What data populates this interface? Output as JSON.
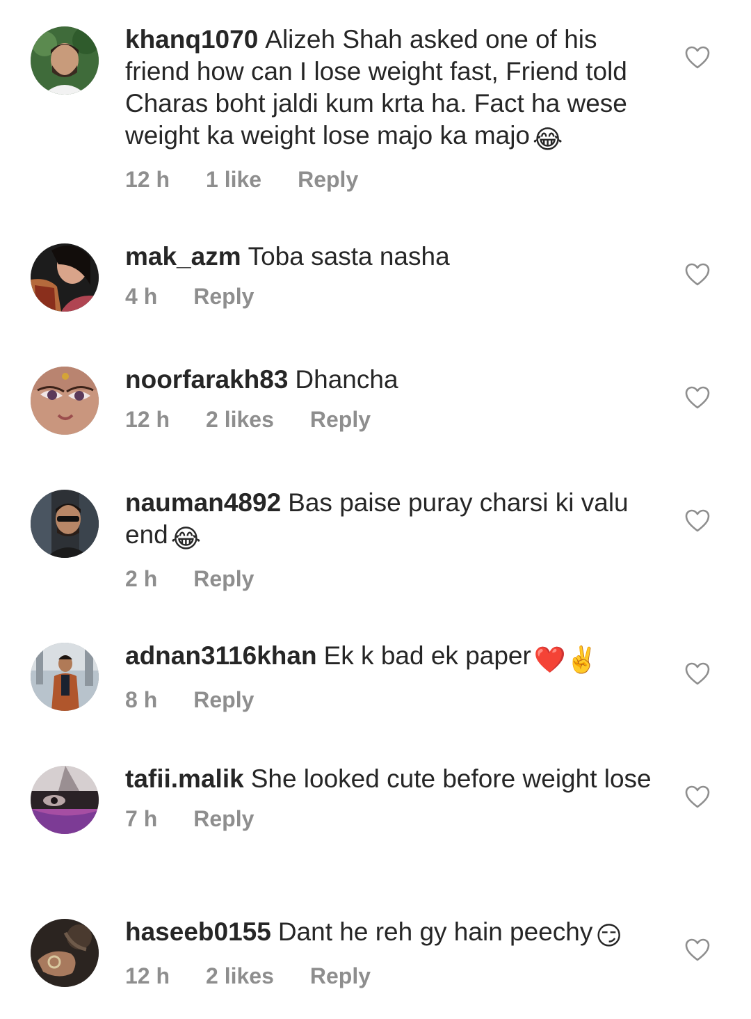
{
  "comments": [
    {
      "username": "khanq1070",
      "text": "Alizeh Shah asked one of his friend how can I lose weight fast, Friend told Charas boht jaldi kum krta ha. Fact ha wese weight ka weight lose majo ka majo",
      "emojis": "😂",
      "time": "12 h",
      "likes": "1 like",
      "reply": "Reply"
    },
    {
      "username": "mak_azm",
      "text": "Toba sasta nasha",
      "emojis": "",
      "time": "4 h",
      "likes": "",
      "reply": "Reply"
    },
    {
      "username": "noorfarakh83",
      "text": "Dhancha",
      "emojis": "",
      "time": "12 h",
      "likes": "2 likes",
      "reply": "Reply"
    },
    {
      "username": "nauman4892",
      "text": "Bas paise puray charsi ki valu end",
      "emojis": "😂",
      "time": "2 h",
      "likes": "",
      "reply": "Reply"
    },
    {
      "username": "adnan3116khan",
      "text": "Ek k bad ek paper",
      "emojis": "❤️✌️",
      "time": "8 h",
      "likes": "",
      "reply": "Reply"
    },
    {
      "username": "tafii.malik",
      "text": "She looked cute before weight lose",
      "emojis": "",
      "time": "7 h",
      "likes": "",
      "reply": "Reply"
    },
    {
      "username": "haseeb0155",
      "text": "Dant he reh gy hain peechy",
      "emojis": "😏",
      "time": "12 h",
      "likes": "2 likes",
      "reply": "Reply"
    }
  ],
  "icons": {
    "avatar": "user-avatar",
    "like": "heart-outline-icon"
  },
  "colors": {
    "text": "#262626",
    "meta": "#8e8e8e",
    "heart_stroke": "#8e8e8e"
  }
}
